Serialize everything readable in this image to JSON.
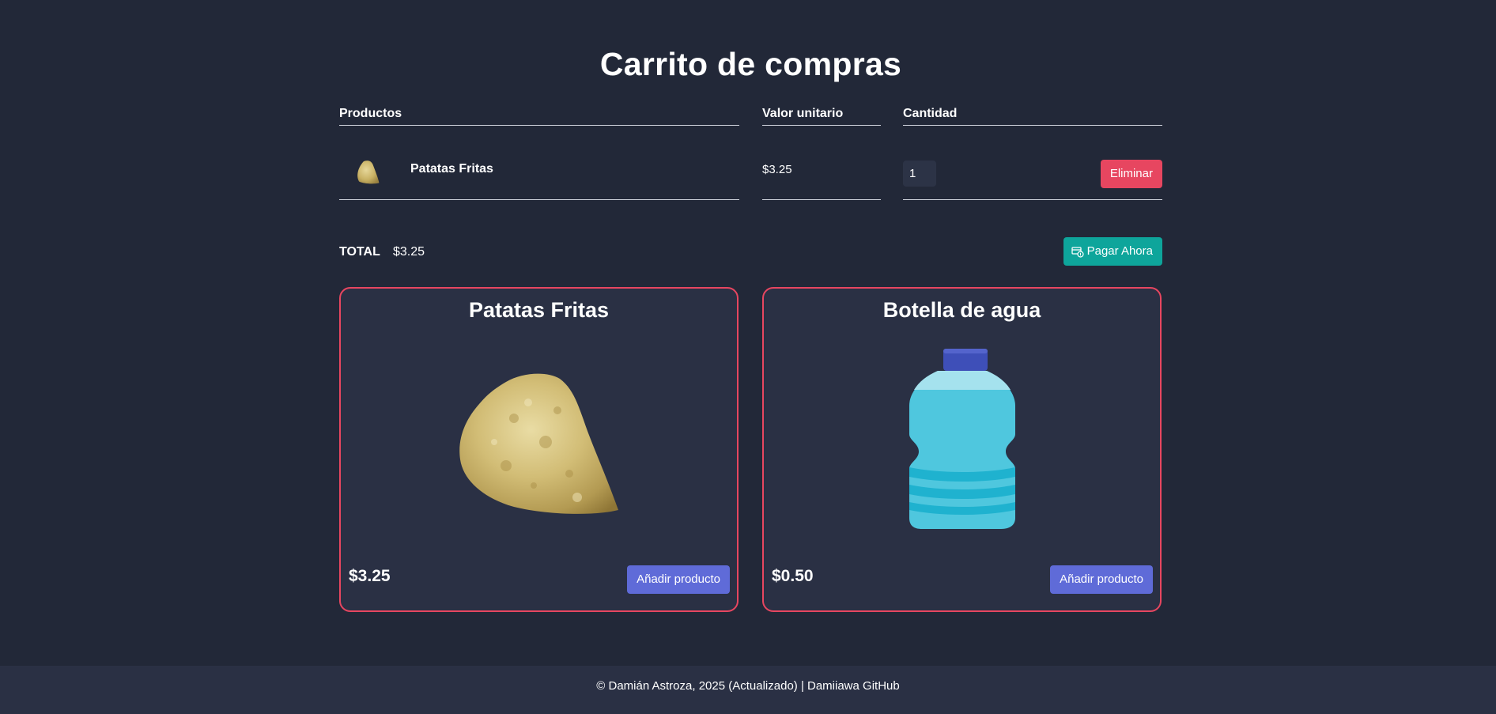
{
  "page": {
    "title": "Carrito de compras"
  },
  "cart": {
    "headers": {
      "products": "Productos",
      "unit_price": "Valor unitario",
      "quantity": "Cantidad"
    },
    "items": [
      {
        "name": "Patatas Fritas",
        "price": "$3.25",
        "quantity": "1",
        "delete_label": "Eliminar"
      }
    ]
  },
  "totals": {
    "label": "TOTAL",
    "value": "$3.25",
    "pay_label": "Pagar Ahora"
  },
  "products": [
    {
      "title": "Patatas Fritas",
      "price": "$3.25",
      "add_label": "Añadir producto",
      "image": "potato-chip-image"
    },
    {
      "title": "Botella de agua",
      "price": "$0.50",
      "add_label": "Añadir producto",
      "image": "water-bottle-image"
    }
  ],
  "footer": {
    "text": "© Damián Astroza, 2025 (Actualizado) | Damiiawa GitHub"
  },
  "colors": {
    "background": "#222838",
    "card_background": "#2a3044",
    "accent_red": "#e74660",
    "accent_teal": "#0ea59b",
    "accent_blue": "#5f6bd8"
  }
}
